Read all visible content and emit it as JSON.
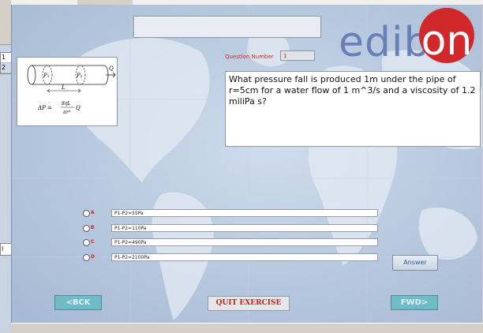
{
  "background_app": {
    "rows": [
      "1",
      "2"
    ],
    "cell": "l"
  },
  "logo": {
    "text_left": "edib",
    "text_circle": "on",
    "accent": "#d1282c",
    "text_color": "#6a7fb8"
  },
  "title_box": {
    "value": ""
  },
  "question_number": {
    "label": "Question Number",
    "value": "1"
  },
  "formula": {
    "p1": "P₁",
    "p2": "P₂",
    "flow": "Q",
    "length": "L",
    "equation_lhs": "ΔP =",
    "equation_num": "8ηL",
    "equation_den": "πr⁴",
    "equation_tail": "Q"
  },
  "question_text": "What pressure fall is produced 1m under the pipe of r=5cm for a water flow of 1 m^3/s and a viscosity of 1.2 miliPa s?",
  "options": [
    {
      "letter": "A",
      "text": "P1-P2=55Pa"
    },
    {
      "letter": "B",
      "text": "P1-P2=110Pa"
    },
    {
      "letter": "C",
      "text": "P1-P2=490Pa"
    },
    {
      "letter": "D",
      "text": "P1-P2=2100Pa"
    }
  ],
  "buttons": {
    "answer": "Answer",
    "back": "<BCK",
    "quit": "QUIT EXERCISE",
    "forward": "FWD>"
  }
}
